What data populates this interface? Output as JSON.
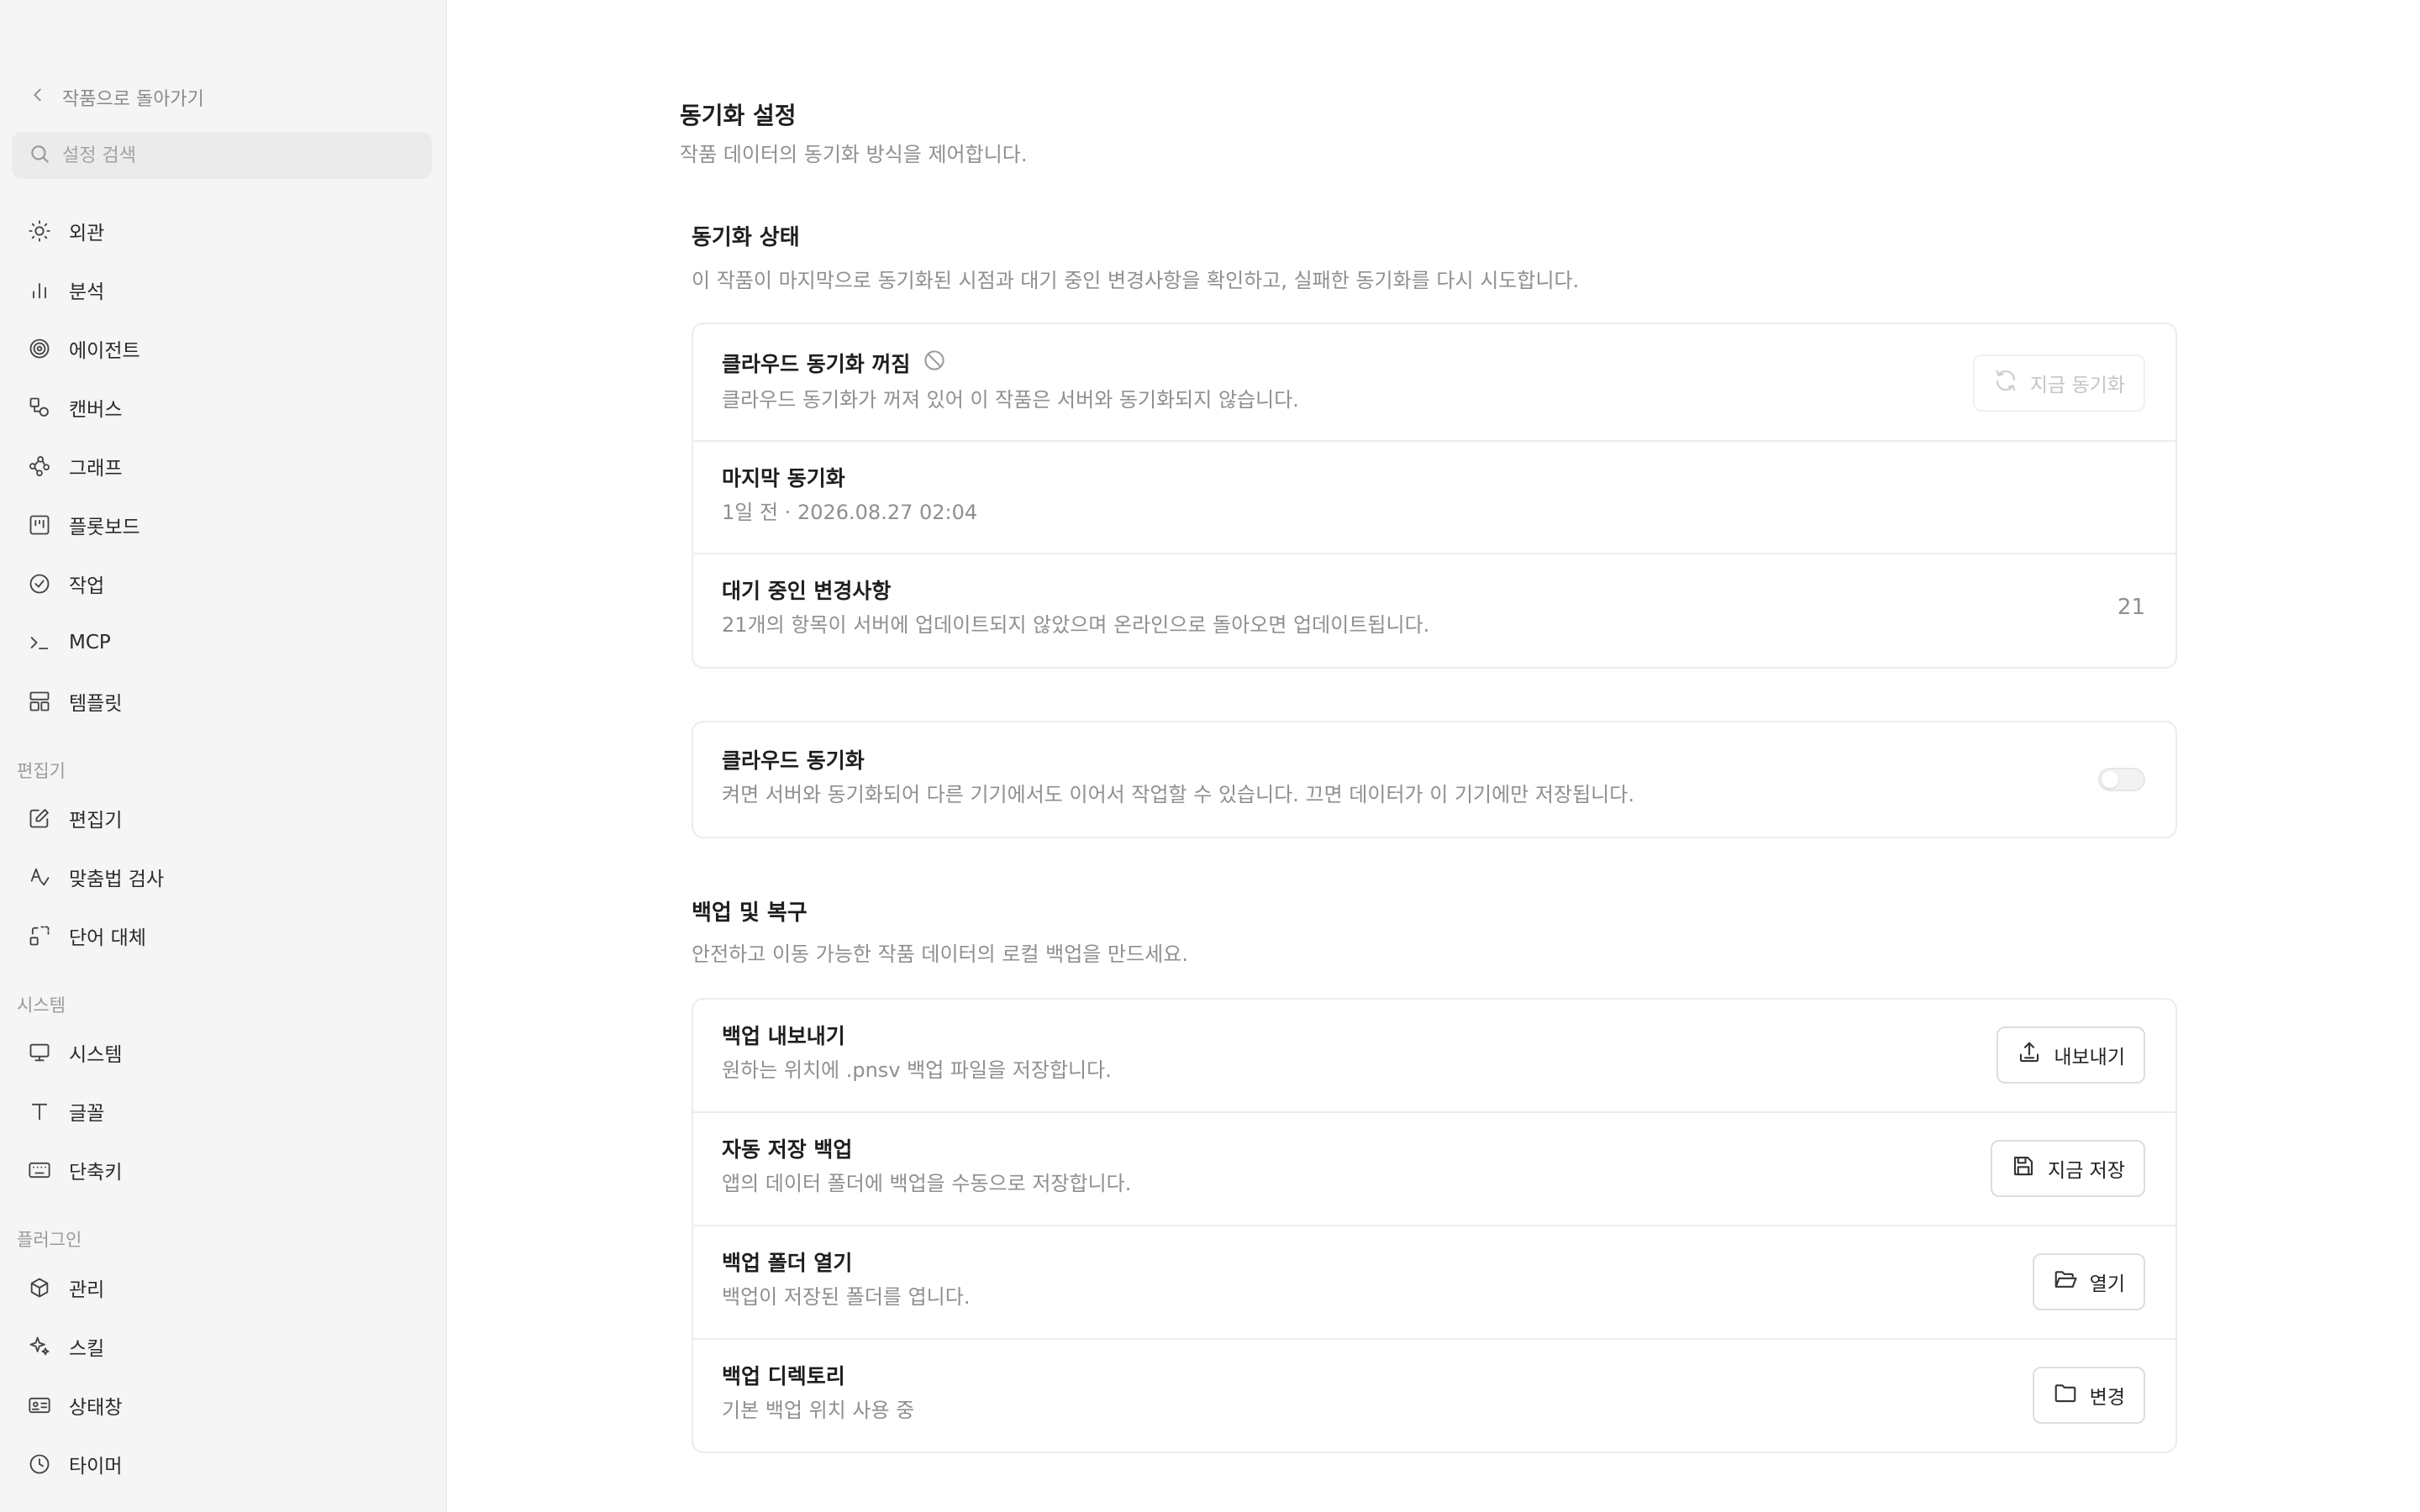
{
  "sidebar": {
    "back_label": "작품으로 돌아가기",
    "search_placeholder": "설정 검색",
    "items": [
      {
        "label": "외관",
        "icon": "sun-icon"
      },
      {
        "label": "분석",
        "icon": "bar-chart-icon"
      },
      {
        "label": "에이전트",
        "icon": "spiral-icon"
      },
      {
        "label": "캔버스",
        "icon": "shapes-icon"
      },
      {
        "label": "그래프",
        "icon": "graph-icon"
      },
      {
        "label": "플롯보드",
        "icon": "board-icon"
      },
      {
        "label": "작업",
        "icon": "check-circle-icon"
      },
      {
        "label": "MCP",
        "icon": "terminal-icon"
      },
      {
        "label": "템플릿",
        "icon": "template-icon"
      }
    ],
    "section_editor": "편집기",
    "editor_items": [
      {
        "label": "편집기",
        "icon": "edit-icon"
      },
      {
        "label": "맞춤법 검사",
        "icon": "spellcheck-icon"
      },
      {
        "label": "단어 대체",
        "icon": "replace-icon"
      }
    ],
    "section_system": "시스템",
    "system_items": [
      {
        "label": "시스템",
        "icon": "monitor-icon"
      },
      {
        "label": "글꼴",
        "icon": "type-icon"
      },
      {
        "label": "단축키",
        "icon": "keyboard-icon"
      }
    ],
    "section_plugins": "플러그인",
    "plugin_items": [
      {
        "label": "관리",
        "icon": "package-icon"
      },
      {
        "label": "스킬",
        "icon": "sparkles-icon"
      },
      {
        "label": "상태창",
        "icon": "id-card-icon"
      },
      {
        "label": "타이머",
        "icon": "clock-icon"
      }
    ]
  },
  "main": {
    "title": "동기화 설정",
    "subtitle": "작품 데이터의 동기화 방식을 제어합니다.",
    "sync_status": {
      "title": "동기화 상태",
      "subtitle": "이 작품이 마지막으로 동기화된 시점과 대기 중인 변경사항을 확인하고, 실패한 동기화를 다시 시도합니다.",
      "cloud_off_title": "클라우드 동기화 꺼짐",
      "cloud_off_desc": "클라우드 동기화가 꺼져 있어 이 작품은 서버와 동기화되지 않습니다.",
      "sync_now_label": "지금 동기화",
      "last_sync_title": "마지막 동기화",
      "last_sync_value": "1일 전 · 2026.08.27 02:04",
      "pending_title": "대기 중인 변경사항",
      "pending_desc": "21개의 항목이 서버에 업데이트되지 않았으며 온라인으로 돌아오면 업데이트됩니다.",
      "pending_count": "21"
    },
    "cloud_sync": {
      "title": "클라우드 동기화",
      "desc": "켜면 서버와 동기화되어 다른 기기에서도 이어서 작업할 수 있습니다. 끄면 데이터가 이 기기에만 저장됩니다.",
      "enabled": false
    },
    "backup": {
      "title": "백업 및 복구",
      "subtitle": "안전하고 이동 가능한 작품 데이터의 로컬 백업을 만드세요.",
      "export_title": "백업 내보내기",
      "export_desc": "원하는 위치에 .pnsv 백업 파일을 저장합니다.",
      "export_label": "내보내기",
      "autosave_title": "자동 저장 백업",
      "autosave_desc": "앱의 데이터 폴더에 백업을 수동으로 저장합니다.",
      "save_now_label": "지금 저장",
      "open_folder_title": "백업 폴더 열기",
      "open_folder_desc": "백업이 저장된 폴더를 엽니다.",
      "open_label": "열기",
      "directory_title": "백업 디렉토리",
      "directory_desc": "기본 백업 위치 사용 중",
      "change_label": "변경"
    }
  },
  "colors": {
    "sidebar_bg": "#f5f5f5",
    "border": "#ececec",
    "muted_text": "#8f8f8f"
  }
}
